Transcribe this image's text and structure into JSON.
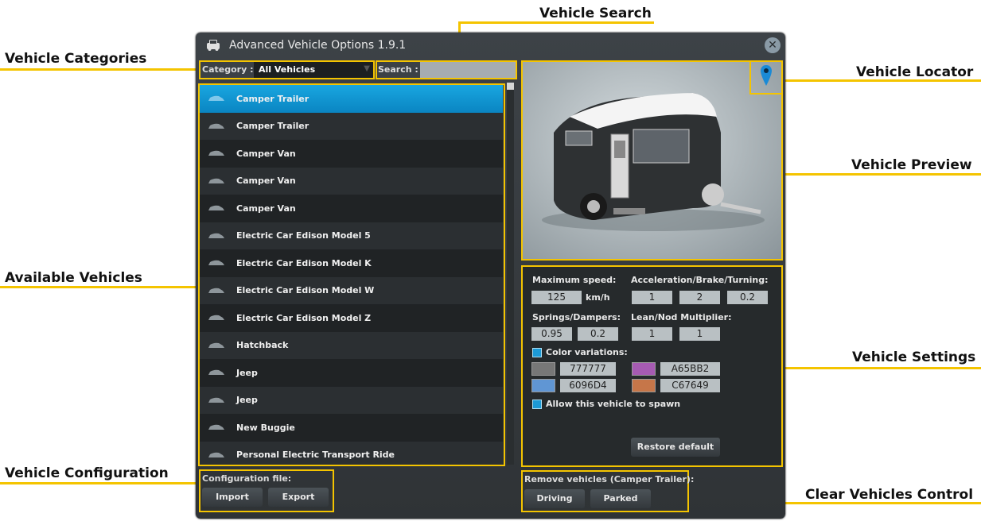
{
  "callouts": {
    "vehicle_search": "Vehicle Search",
    "vehicle_categories": "Vehicle Categories",
    "vehicle_locator": "Vehicle Locator",
    "vehicle_preview": "Vehicle Preview",
    "available_vehicles": "Available Vehicles",
    "vehicle_settings": "Vehicle Settings",
    "vehicle_configuration": "Vehicle Configuration",
    "clear_vehicles_control": "Clear Vehicles Control"
  },
  "window": {
    "title": "Advanced Vehicle Options 1.9.1",
    "close_icon": "close-icon",
    "app_icon": "car-icon"
  },
  "filter": {
    "category_label": "Category :",
    "category_value": "All Vehicles",
    "search_label": "Search :",
    "search_value": ""
  },
  "vehicles": [
    {
      "name": "Camper Trailer",
      "selected": true
    },
    {
      "name": "Camper Trailer",
      "selected": false
    },
    {
      "name": "Camper Van",
      "selected": false
    },
    {
      "name": "Camper Van",
      "selected": false
    },
    {
      "name": "Camper Van",
      "selected": false
    },
    {
      "name": "Electric Car Edison Model 5",
      "selected": false
    },
    {
      "name": "Electric Car Edison Model K",
      "selected": false
    },
    {
      "name": "Electric Car Edison Model W",
      "selected": false
    },
    {
      "name": "Electric Car Edison Model Z",
      "selected": false
    },
    {
      "name": "Hatchback",
      "selected": false
    },
    {
      "name": "Jeep",
      "selected": false
    },
    {
      "name": "Jeep",
      "selected": false
    },
    {
      "name": "New Buggie",
      "selected": false
    },
    {
      "name": "Personal Electric Transport Ride",
      "selected": false
    }
  ],
  "settings": {
    "max_speed_label": "Maximum speed:",
    "max_speed_value": "125",
    "max_speed_unit": "km/h",
    "abt_label": "Acceleration/Brake/Turning:",
    "acceleration": "1",
    "brake": "2",
    "turning": "0.2",
    "springs_label": "Springs/Dampers:",
    "springs": "0.95",
    "dampers": "0.2",
    "lean_label": "Lean/Nod Multiplier:",
    "lean": "1",
    "nod": "1",
    "color_variations_label": "Color variations:",
    "colors": [
      {
        "hex": "777777",
        "swatch": "#777777"
      },
      {
        "hex": "A65BB2",
        "swatch": "#A65BB2"
      },
      {
        "hex": "6096D4",
        "swatch": "#6096D4"
      },
      {
        "hex": "C67649",
        "swatch": "#C67649"
      }
    ],
    "allow_spawn_label": "Allow this vehicle to spawn",
    "restore_label": "Restore default"
  },
  "config": {
    "label": "Configuration file:",
    "import_label": "Import",
    "export_label": "Export"
  },
  "remove": {
    "label": "Remove vehicles (Camper Trailer):",
    "driving_label": "Driving",
    "parked_label": "Parked"
  },
  "accent": "#f4c400"
}
